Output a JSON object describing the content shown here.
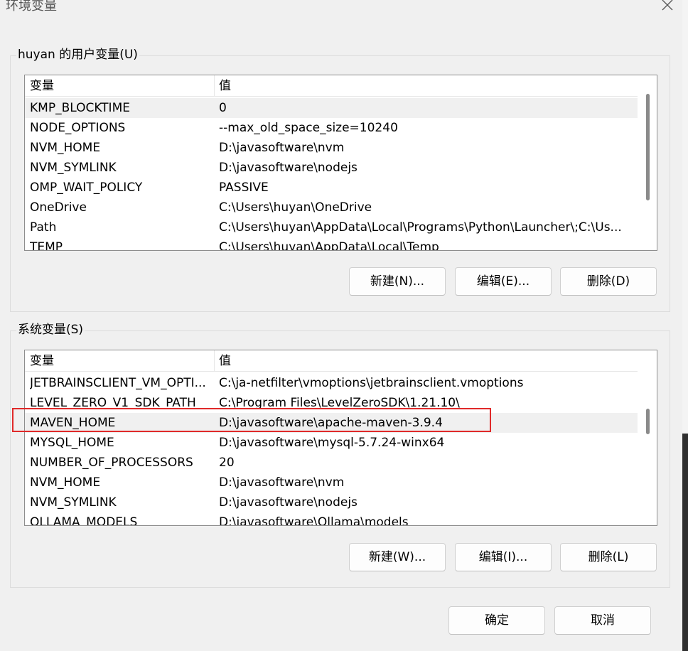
{
  "window": {
    "title": "环境变量",
    "close_icon": "close-icon"
  },
  "user_vars": {
    "group_label": "huyan 的用户变量(U)",
    "columns": {
      "name": "变量",
      "value": "值"
    },
    "rows": [
      {
        "name": "KMP_BLOCKTIME",
        "value": "0"
      },
      {
        "name": "NODE_OPTIONS",
        "value": "--max_old_space_size=10240"
      },
      {
        "name": "NVM_HOME",
        "value": "D:\\javasoftware\\nvm"
      },
      {
        "name": "NVM_SYMLINK",
        "value": "D:\\javasoftware\\nodejs"
      },
      {
        "name": "OMP_WAIT_POLICY",
        "value": "PASSIVE"
      },
      {
        "name": "OneDrive",
        "value": "C:\\Users\\huyan\\OneDrive"
      },
      {
        "name": "Path",
        "value": "C:\\Users\\huyan\\AppData\\Local\\Programs\\Python\\Launcher\\;C:\\Us..."
      },
      {
        "name": "TEMP",
        "value": "C:\\Users\\huyan\\AppData\\Local\\Temp"
      }
    ],
    "buttons": {
      "new": "新建(N)...",
      "edit": "编辑(E)...",
      "delete": "删除(D)"
    }
  },
  "system_vars": {
    "group_label": "系统变量(S)",
    "columns": {
      "name": "变量",
      "value": "值"
    },
    "rows": [
      {
        "name": "JETBRAINSCLIENT_VM_OPTI...",
        "value": "C:\\ja-netfilter\\vmoptions\\jetbrainsclient.vmoptions"
      },
      {
        "name": "LEVEL_ZERO_V1_SDK_PATH",
        "value": "C:\\Program Files\\LevelZeroSDK\\1.21.10\\"
      },
      {
        "name": "MAVEN_HOME",
        "value": "D:\\javasoftware\\apache-maven-3.9.4"
      },
      {
        "name": "MYSQL_HOME",
        "value": "D:\\javasoftware\\mysql-5.7.24-winx64"
      },
      {
        "name": "NUMBER_OF_PROCESSORS",
        "value": "20"
      },
      {
        "name": "NVM_HOME",
        "value": "D:\\javasoftware\\nvm"
      },
      {
        "name": "NVM_SYMLINK",
        "value": "D:\\javasoftware\\nodejs"
      },
      {
        "name": "OLLAMA_MODELS",
        "value": "D:\\javasoftware\\Ollama\\models"
      }
    ],
    "buttons": {
      "new": "新建(W)...",
      "edit": "编辑(I)...",
      "delete": "删除(L)"
    }
  },
  "footer": {
    "ok": "确定",
    "cancel": "取消"
  },
  "colors": {
    "highlight": "#e02a2a",
    "selected_row": "#f0f0f0",
    "background": "#f0f0f0"
  }
}
